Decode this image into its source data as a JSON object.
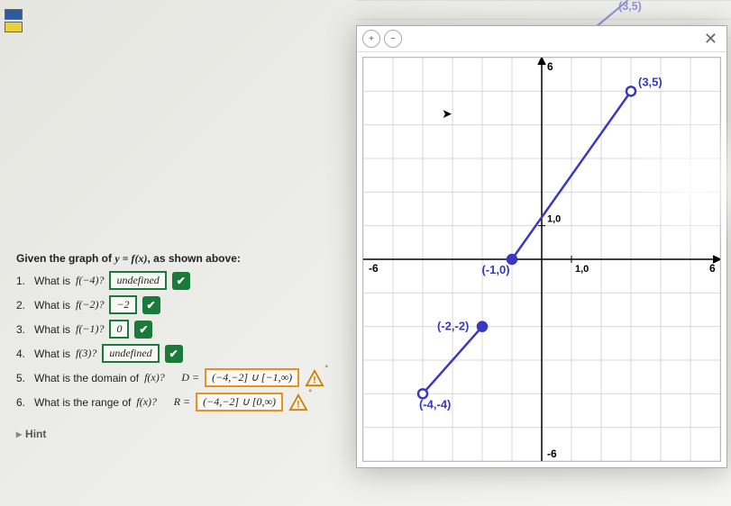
{
  "side": {
    "marks": [
      "blue",
      "yellow"
    ]
  },
  "intro_prefix": "Given the graph of ",
  "intro_eq": "y = f(x)",
  "intro_suffix": ", as shown above:",
  "questions": [
    {
      "num": "1.",
      "prompt_a": "What is ",
      "prompt_b": "f(−4)?",
      "answer": "undefined",
      "status": "correct"
    },
    {
      "num": "2.",
      "prompt_a": "What is ",
      "prompt_b": "f(−2)?",
      "answer": "−2",
      "status": "correct"
    },
    {
      "num": "3.",
      "prompt_a": "What is ",
      "prompt_b": "f(−1)?",
      "answer": "0",
      "status": "correct"
    },
    {
      "num": "4.",
      "prompt_a": "What is ",
      "prompt_b": "f(3)?",
      "answer": "undefined",
      "status": "correct"
    },
    {
      "num": "5.",
      "prompt_a": "What is the domain of ",
      "prompt_b": "f(x)?",
      "lhs": "D =",
      "answer": "(−4,−2] ∪ [−1,∞)",
      "status": "warn"
    },
    {
      "num": "6.",
      "prompt_a": "What is the range of ",
      "prompt_b": "f(x)?",
      "lhs": "R =",
      "answer": "(−4,−2] ∪ [0,∞)",
      "status": "warn"
    }
  ],
  "hint_label": "Hint",
  "toolbar": {
    "zoom_in": "+",
    "zoom_out": "−",
    "close": "✕"
  },
  "chart_data": {
    "type": "line",
    "title": "",
    "xlabel": "",
    "ylabel": "",
    "xlim": [
      -6,
      6
    ],
    "ylim": [
      -6,
      6
    ],
    "grid": true,
    "axis_ticks_x": [
      -6,
      6
    ],
    "axis_ticks_y": [
      -6,
      6
    ],
    "axis_marker_labels": [
      "1,0",
      "1,0"
    ],
    "series": [
      {
        "name": "segment-lower",
        "points": [
          {
            "x": -4,
            "y": -4,
            "open": true,
            "label": "(-4,-4)"
          },
          {
            "x": -2,
            "y": -2,
            "open": false,
            "label": "(-2,-2)"
          }
        ]
      },
      {
        "name": "segment-upper",
        "points": [
          {
            "x": -1,
            "y": 0,
            "open": false,
            "label": "(-1,0)"
          },
          {
            "x": 3,
            "y": 5,
            "open": true,
            "label": "(3,5)"
          }
        ]
      }
    ],
    "bg_label": "(3,5)"
  }
}
